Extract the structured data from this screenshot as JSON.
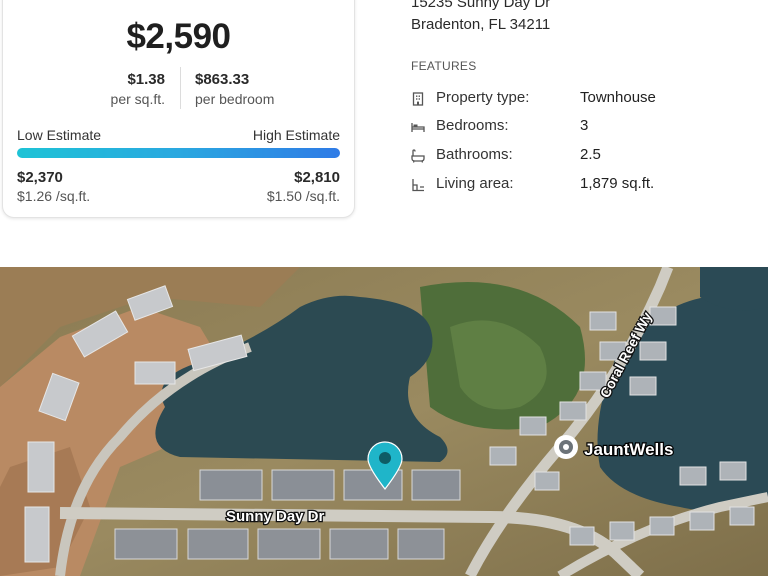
{
  "estimate": {
    "price": "$2,590",
    "per_sqft_value": "$1.38",
    "per_sqft_label": "per sq.ft.",
    "per_bedroom_value": "$863.33",
    "per_bedroom_label": "per bedroom",
    "low_label": "Low Estimate",
    "high_label": "High Estimate",
    "low_value": "$2,370",
    "low_sqft": "$1.26 /sq.ft.",
    "high_value": "$2,810",
    "high_sqft": "$1.50 /sq.ft.",
    "bar_colors": [
      "#1ec3d6",
      "#2f7be6"
    ]
  },
  "address": {
    "line1": "15235 Sunny Day Dr",
    "line2": "Bradenton, FL 34211"
  },
  "features": {
    "heading": "FEATURES",
    "items": [
      {
        "icon": "building-icon",
        "label": "Property type:",
        "value": "Townhouse"
      },
      {
        "icon": "bed-icon",
        "label": "Bedrooms:",
        "value": "3"
      },
      {
        "icon": "bathtub-icon",
        "label": "Bathrooms:",
        "value": "2.5"
      },
      {
        "icon": "floorplan-icon",
        "label": "Living area:",
        "value": "1,879 sq.ft."
      }
    ]
  },
  "map": {
    "street_label": "Sunny Day Dr",
    "road_label": "Coral Reef Wy",
    "place_label": "JauntWells",
    "pin_color": "#1fb5c9"
  }
}
